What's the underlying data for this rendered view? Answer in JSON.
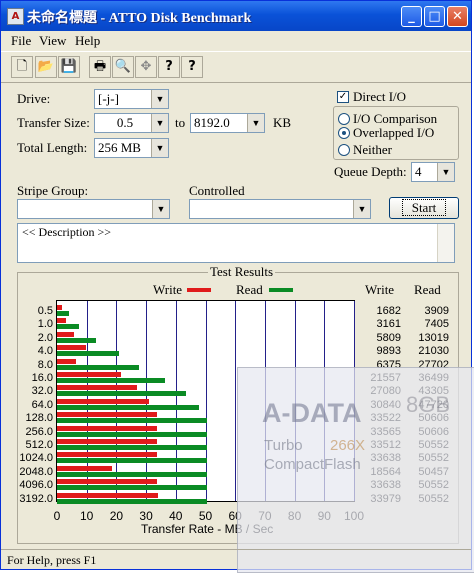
{
  "window": {
    "title": "未命名標題 - ATTO Disk Benchmark",
    "minimize": "_",
    "maximize": "□",
    "close": "✕",
    "app_icon_glyph": "A"
  },
  "menu": [
    "File",
    "View",
    "Help"
  ],
  "toolbar": {
    "icons": [
      "new-file-icon",
      "open-folder-icon",
      "save-icon",
      "print-icon",
      "print-preview-icon",
      "move-icon",
      "help-icon",
      "context-help-icon"
    ],
    "glyphs": [
      "🗋",
      "📂",
      "💾",
      "🖶",
      "🔍",
      "✥",
      "?",
      "?"
    ]
  },
  "form": {
    "drive_label": "Drive:",
    "drive_value": "[-j-]",
    "transfer_size_label": "Transfer Size:",
    "transfer_from": "0.5",
    "to_label": "to",
    "transfer_to": "8192.0",
    "kb_label": "KB",
    "total_length_label": "Total Length:",
    "total_length_value": "256 MB",
    "direct_io_label": "Direct I/O",
    "direct_io_checked": "✓",
    "io_comparison_label": "I/O Comparison",
    "overlapped_io_label": "Overlapped I/O",
    "neither_label": "Neither",
    "queue_depth_label": "Queue Depth:",
    "queue_depth_value": "4",
    "stripe_group_label": "Stripe Group:",
    "controlled_label": "Controlled",
    "start_label": "Start",
    "description": "<< Description >>"
  },
  "results": {
    "title": "Test Results",
    "write_legend": "Write",
    "read_legend": "Read",
    "write_col": "Write",
    "read_col": "Read",
    "xlabel": "Transfer Rate - MB / Sec"
  },
  "chart_data": {
    "type": "bar",
    "title": "Test Results",
    "xlabel": "Transfer Rate - MB / Sec",
    "xlim": [
      0,
      100
    ],
    "xticks": [
      "0",
      "10",
      "20",
      "30",
      "40",
      "50",
      "60",
      "70",
      "80",
      "90",
      "100"
    ],
    "colors": {
      "write": "#e01b1b",
      "read": "#0a8b24",
      "grid": "#23208a"
    },
    "categories": [
      "0.5",
      "1.0",
      "2.0",
      "4.0",
      "8.0",
      "16.0",
      "32.0",
      "64.0",
      "128.0",
      "256.0",
      "512.0",
      "1024.0",
      "2048.0",
      "4096.0",
      "3192.0"
    ],
    "series": [
      {
        "name": "Write",
        "values": [
          1682,
          3161,
          5809,
          9893,
          6375,
          21557,
          27080,
          30840,
          33522,
          33565,
          33512,
          33638,
          18564,
          33638,
          33979
        ]
      },
      {
        "name": "Read",
        "values": [
          3909,
          7405,
          13019,
          21030,
          27702,
          36499,
          43305,
          47720,
          50606,
          50606,
          50552,
          50552,
          50457,
          50552,
          50552
        ]
      }
    ]
  },
  "overlay": {
    "brand": "A-DATA",
    "capacity": "8GB",
    "turbo": "Turbo",
    "speed": "266X",
    "cf": "CompactFlash"
  },
  "status": {
    "text": "For Help, press F1"
  }
}
